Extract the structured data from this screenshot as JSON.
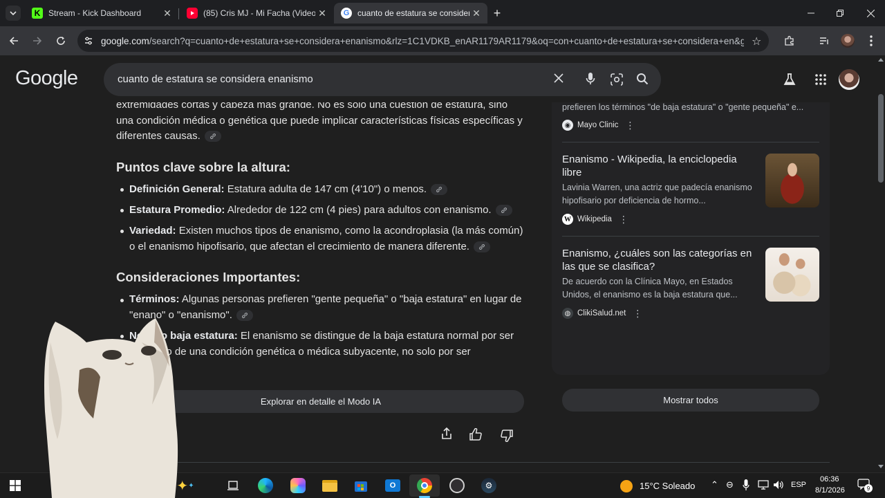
{
  "browser": {
    "tabs": [
      {
        "title": "Stream - Kick Dashboard",
        "active": false,
        "icon": "kick-icon"
      },
      {
        "title": "(85) Cris MJ - Mi Facha (Video O",
        "active": false,
        "icon": "youtube-icon"
      },
      {
        "title": "cuanto de estatura se considera",
        "active": true,
        "icon": "google-icon"
      }
    ],
    "url_host": "google.com",
    "url_path": "/search?q=cuanto+de+estatura+se+considera+enanismo&rlz=1C1VDKB_enAR1179AR1179&oq=con+cuanto+de+estatura+se+considera+en&gs..."
  },
  "search": {
    "logo": "Google",
    "query": "cuanto de estatura se considera enanismo"
  },
  "answer": {
    "intro_lines": [
      "extremidades cortas y cabeza más grande. No es solo una cuestión de estatura, sino",
      "una condición médica o genética que puede implicar características físicas específicas y",
      "diferentes causas."
    ],
    "section1_title": "Puntos clave sobre la altura:",
    "bullets1": [
      {
        "label": "Definición General:",
        "text": " Estatura adulta de 147 cm (4'10\") o menos."
      },
      {
        "label": "Estatura Promedio:",
        "text": " Alrededor de 122 cm (4 pies) para adultos con enanismo."
      },
      {
        "label": "Variedad:",
        "text": " Existen muchos tipos de enanismo, como la acondroplasia (la más común) o el enanismo hipofisario, que afectan el crecimiento de manera diferente."
      }
    ],
    "section2_title": "Consideraciones Importantes:",
    "bullets2": [
      {
        "label": "Términos:",
        "text": " Algunas personas prefieren \"gente pequeña\" o \"baja estatura\" en lugar de \"enano\" o \"enanismo\"."
      },
      {
        "label": "No solo baja estatura:",
        "text": " El enanismo se distingue de la baja estatura normal por ser resultado de una condición genética o médica subyacente, no solo por ser"
      }
    ],
    "explore_label": "Explorar en detalle el Modo IA"
  },
  "sources": {
    "top_snippet": "prefieren los términos \"de baja estatura\" o \"gente pequeña\" e...",
    "top_source": "Mayo Clinic",
    "cards": [
      {
        "title": "Enanismo - Wikipedia, la enciclopedia libre",
        "snippet": "Lavinia Warren, una actriz que padecía enanismo hipofisario por deficiencia de hormo...",
        "source": "Wikipedia"
      },
      {
        "title": "Enanismo, ¿cuáles son las categorías en las que se clasifica?",
        "snippet": "De acuerdo con la Clínica Mayo, en Estados Unidos, el enanismo es la baja estatura que...",
        "source": "ClikiSalud.net"
      }
    ],
    "show_all": "Mostrar todos"
  },
  "taskbar": {
    "weather": "15°C  Soleado",
    "lang": "ESP",
    "time": "06:36",
    "date": "8/1/2026",
    "notif_count": "9"
  }
}
